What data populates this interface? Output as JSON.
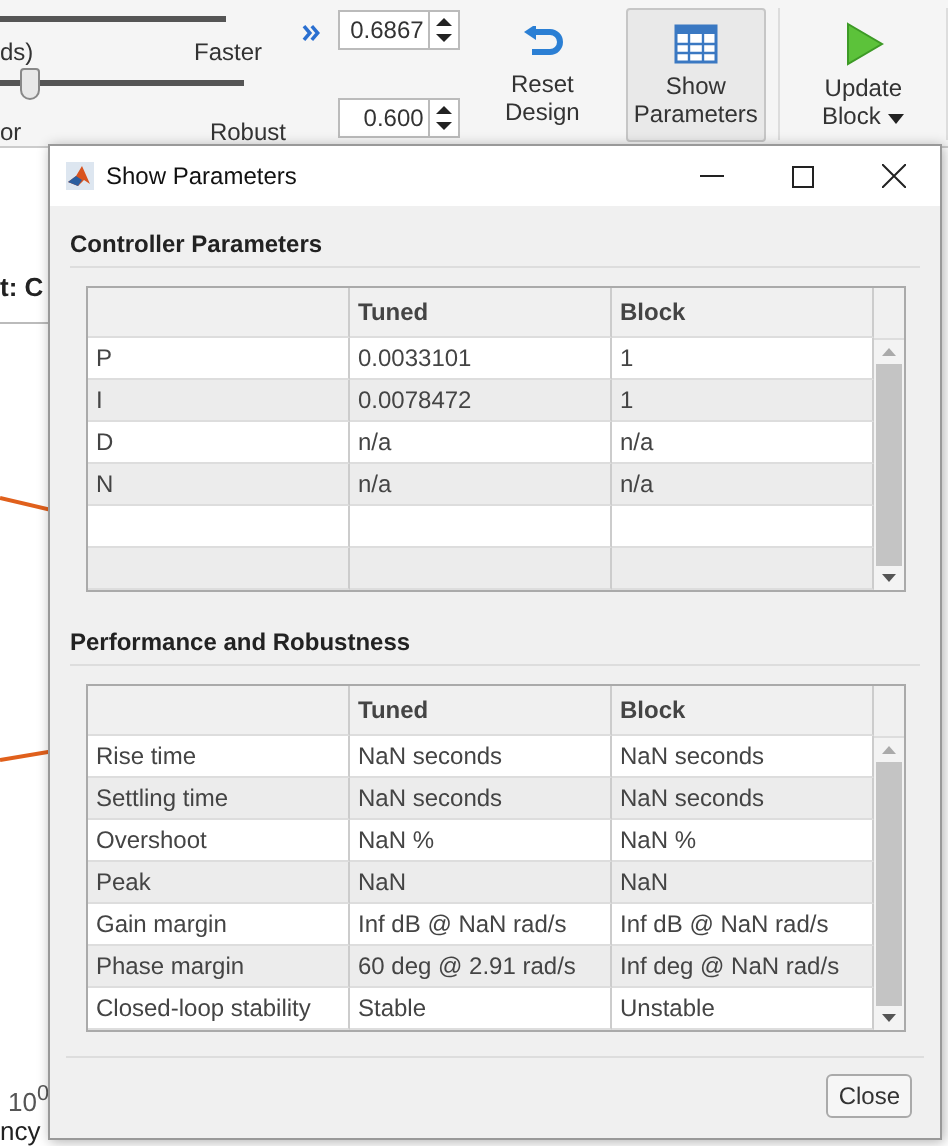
{
  "toolbar": {
    "sliders": [
      {
        "left_label": "ds)",
        "right_label": "Faster"
      },
      {
        "left_label": "or",
        "right_label": "Robust",
        "level": 0.12
      }
    ],
    "fields": [
      {
        "value": "0.6867"
      },
      {
        "value": "0.600"
      }
    ],
    "buttons": [
      {
        "kind": "reset",
        "label": "Reset Design",
        "selected": false,
        "dropdown": false
      },
      {
        "kind": "table",
        "label": "Show Parameters",
        "selected": true,
        "dropdown": false
      },
      {
        "kind": "update",
        "label": "Update Block",
        "selected": false,
        "dropdown": true
      }
    ]
  },
  "plot": {
    "title": "t: C",
    "tick_label": "10$^{0}$",
    "axis_label": "ncy"
  },
  "dialog": {
    "title": "Show Parameters",
    "sections": [
      {
        "title": "Controller Parameters",
        "columns": [
          "Tuned",
          "Block"
        ],
        "rows": [
          {
            "name": "P",
            "tuned": "0.0033101",
            "block": "1"
          },
          {
            "name": "I",
            "tuned": "0.0078472",
            "block": "1"
          },
          {
            "name": "D",
            "tuned": "n/a",
            "block": "n/a"
          },
          {
            "name": "N",
            "tuned": "n/a",
            "block": "n/a"
          }
        ]
      },
      {
        "title": "Performance and Robustness",
        "columns": [
          "Tuned",
          "Block"
        ],
        "rows": [
          {
            "name": "Rise time",
            "tuned": "NaN seconds",
            "block": "NaN seconds"
          },
          {
            "name": "Settling time",
            "tuned": "NaN seconds",
            "block": "NaN seconds"
          },
          {
            "name": "Overshoot",
            "tuned": "NaN %",
            "block": "NaN %"
          },
          {
            "name": "Peak",
            "tuned": "NaN",
            "block": "NaN"
          },
          {
            "name": "Gain margin",
            "tuned": "Inf dB @ NaN rad/s",
            "block": "Inf dB @ NaN rad/s"
          },
          {
            "name": "Phase margin",
            "tuned": "60 deg @ 2.91 rad/s",
            "block": "Inf deg @ NaN rad/s"
          },
          {
            "name": "Closed-loop stability",
            "tuned": "Stable",
            "block": "Unstable"
          }
        ]
      }
    ],
    "close_button": "Close"
  }
}
